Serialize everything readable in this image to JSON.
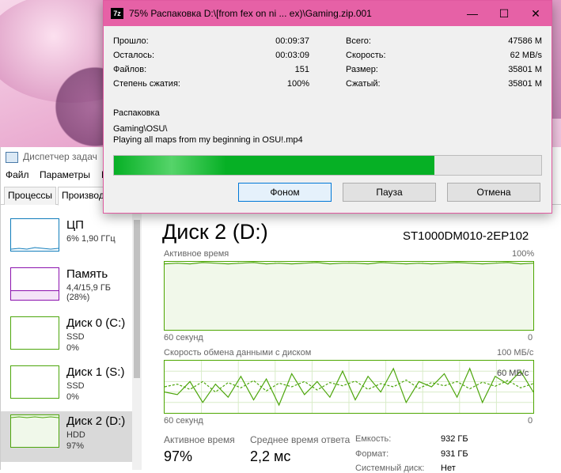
{
  "zip": {
    "title": "75% Распаковка D:\\[from fex on ni ... ex)\\Gaming.zip.001",
    "icon_label": "7z",
    "progress": 0.75,
    "left_rows": [
      {
        "label": "Прошло:",
        "value": "00:09:37"
      },
      {
        "label": "Осталось:",
        "value": "00:03:09"
      },
      {
        "label": "Файлов:",
        "value": "151"
      },
      {
        "label": "Степень сжатия:",
        "value": "100%"
      }
    ],
    "right_rows": [
      {
        "label": "Всего:",
        "value": "47586 M"
      },
      {
        "label": "Скорость:",
        "value": "62 MB/s"
      },
      {
        "label": "Размер:",
        "value": "35801 M"
      },
      {
        "label": "Сжатый:",
        "value": "35801 M"
      }
    ],
    "operation": "Распаковка",
    "path": "Gaming\\OSU\\",
    "file": "Playing all maps from my beginning in OSU!.mp4",
    "buttons": {
      "background": "Фоном",
      "pause": "Пауза",
      "cancel": "Отмена"
    },
    "accent": "#e661a6",
    "progress_color": "#06b025"
  },
  "taskmgr": {
    "title": "Диспетчер задач",
    "menu": [
      "Файл",
      "Параметры",
      "В"
    ],
    "tabs": {
      "processes": "Процессы",
      "performance": "Производительность"
    },
    "sidebar": [
      {
        "title": "ЦП",
        "sub1": "6% 1,90 ГГц",
        "sub2": "",
        "color": "#117dbb"
      },
      {
        "title": "Память",
        "sub1": "4,4/15,9 ГБ (28%)",
        "sub2": "",
        "color": "#8b12ae"
      },
      {
        "title": "Диск 0 (C:)",
        "sub1": "SSD",
        "sub2": "0%",
        "color": "#4da60c"
      },
      {
        "title": "Диск 1 (S:)",
        "sub1": "SSD",
        "sub2": "0%",
        "color": "#4da60c"
      },
      {
        "title": "Диск 2 (D:)",
        "sub1": "HDD",
        "sub2": "97%",
        "color": "#4da60c"
      }
    ],
    "main": {
      "title": "Диск 2 (D:)",
      "model": "ST1000DM010-2EP102",
      "chart1": {
        "label": "Активное время",
        "max": "100%",
        "left": "60 секунд",
        "right": "0"
      },
      "chart2": {
        "label": "Скорость обмена данными с диском",
        "max": "100 МБ/с",
        "mid": "60 МБ/с",
        "left": "60 секунд",
        "right": "0"
      },
      "stats": [
        {
          "label": "Активное время",
          "value": "97%"
        },
        {
          "label": "Среднее время ответа",
          "value": "2,2 мс"
        }
      ],
      "kv": [
        {
          "label": "Емкость:",
          "value": "932 ГБ"
        },
        {
          "label": "Формат:",
          "value": "931 ГБ"
        },
        {
          "label": "Системный диск:",
          "value": "Нет"
        }
      ]
    }
  },
  "chart_data": [
    {
      "type": "line",
      "title": "Активное время",
      "ylim": [
        0,
        100
      ],
      "series": [
        {
          "values": [
            97,
            98,
            97,
            99,
            98,
            97,
            98,
            99,
            97,
            98,
            97,
            98,
            99,
            97,
            98,
            98,
            97,
            99,
            98,
            97,
            98,
            97,
            98,
            99,
            98,
            97,
            98,
            99,
            97,
            98
          ]
        }
      ]
    },
    {
      "type": "line",
      "title": "Скорость обмена данными с диском",
      "ylim": [
        0,
        100
      ],
      "series": [
        {
          "values": [
            40,
            35,
            60,
            20,
            55,
            30,
            70,
            25,
            65,
            15,
            75,
            35,
            60,
            30,
            80,
            25,
            70,
            40,
            85,
            20,
            60,
            50,
            75,
            30,
            85,
            20,
            70,
            55,
            80,
            40
          ]
        },
        {
          "values": [
            50,
            55,
            45,
            60,
            40,
            58,
            48,
            62,
            42,
            57,
            50,
            60,
            44,
            58,
            52,
            61,
            45,
            56,
            50,
            63,
            47,
            58,
            52,
            60,
            46,
            59,
            51,
            62,
            48,
            56
          ]
        }
      ]
    }
  ]
}
